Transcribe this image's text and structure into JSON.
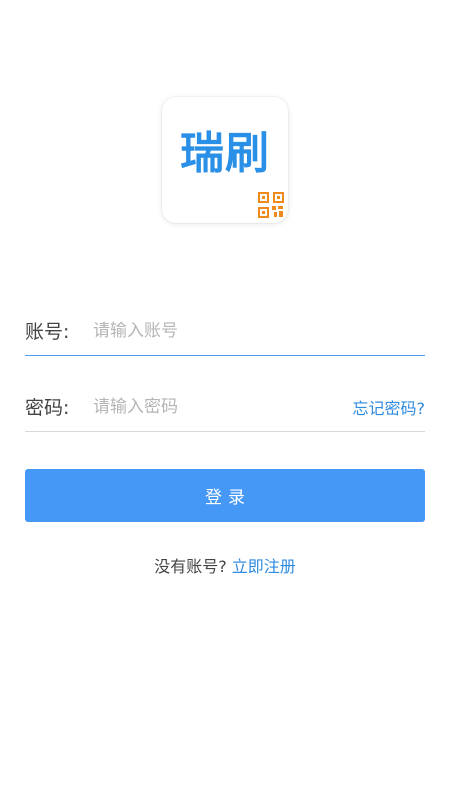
{
  "logo": {
    "text": "瑞刷",
    "accent": "#2a8fe6",
    "qr_color": "#f08a1c"
  },
  "account_field": {
    "label": "账号:",
    "placeholder": "请输入账号",
    "value": ""
  },
  "password_field": {
    "label": "密码:",
    "placeholder": "请输入密码",
    "value": "",
    "forgot_label": "忘记密码?"
  },
  "login_button": {
    "label": "登录",
    "color": "#4598f5"
  },
  "register": {
    "prompt": "没有账号?",
    "link_label": "立即注册"
  },
  "colors": {
    "link": "#2f8be0",
    "active_underline": "#4a9af0"
  }
}
